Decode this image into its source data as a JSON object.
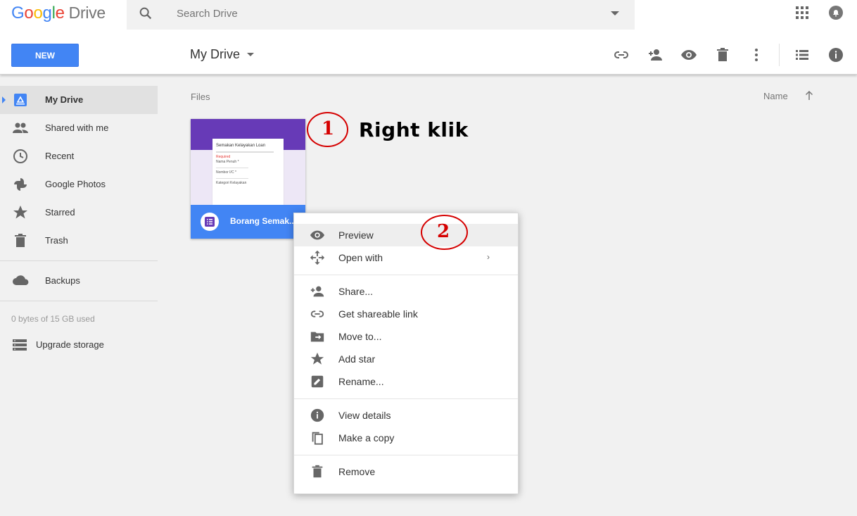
{
  "logo": {
    "g": "G",
    "o1": "o",
    "o2": "o",
    "g2": "g",
    "l": "l",
    "e": "e",
    "drive": "Drive"
  },
  "search": {
    "placeholder": "Search Drive"
  },
  "header": {
    "new_label": "NEW",
    "title": "My Drive"
  },
  "sidebar": {
    "items": [
      {
        "label": "My Drive",
        "icon": "drive-icon"
      },
      {
        "label": "Shared with me",
        "icon": "people-icon"
      },
      {
        "label": "Recent",
        "icon": "clock-icon"
      },
      {
        "label": "Google Photos",
        "icon": "pinwheel-icon"
      },
      {
        "label": "Starred",
        "icon": "star-icon"
      },
      {
        "label": "Trash",
        "icon": "trash-icon"
      }
    ],
    "backups": "Backups",
    "storage": "0 bytes of 15 GB used",
    "upgrade": "Upgrade storage"
  },
  "main": {
    "files_label": "Files",
    "sort_label": "Name",
    "file": {
      "name": "Borang Semak...",
      "thumb_title": "Semakan Kelayakan Loan",
      "thumb_req": "Required",
      "thumb_field1": "Nama Penuh *",
      "thumb_field2": "Nombor I/C *",
      "thumb_field3": "Kategori Kelayakan"
    }
  },
  "annotations": {
    "step1": "1",
    "step1_text": "Right klik",
    "step2": "2"
  },
  "context_menu": {
    "preview": "Preview",
    "open_with": "Open with",
    "share": "Share...",
    "get_link": "Get shareable link",
    "move_to": "Move to...",
    "add_star": "Add star",
    "rename": "Rename...",
    "view_details": "View details",
    "make_copy": "Make a copy",
    "remove": "Remove",
    "chevron": "›"
  },
  "colors": {
    "accent": "#4285f4",
    "forms": "#673ab7",
    "annotation": "#d50000"
  }
}
